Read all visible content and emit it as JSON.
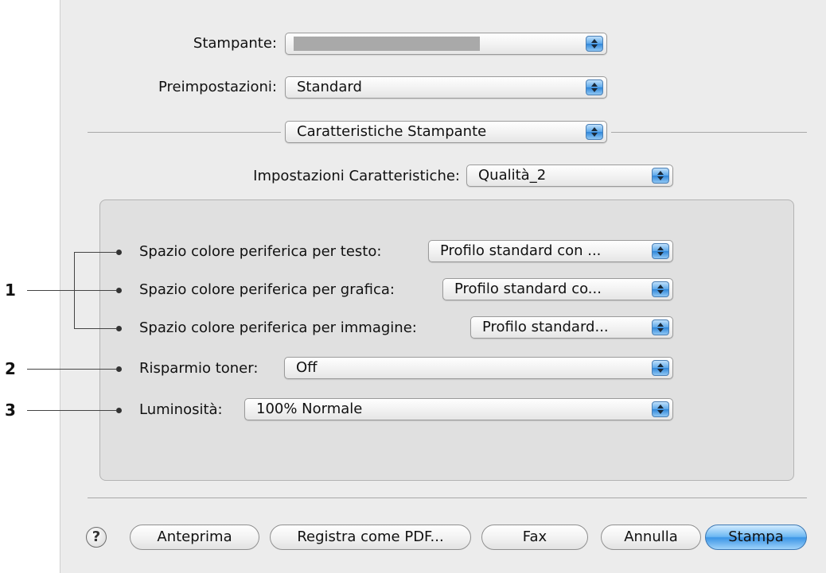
{
  "printer": {
    "label": "Stampante:",
    "value": ""
  },
  "presets": {
    "label": "Preimpostazioni:",
    "value": "Standard"
  },
  "section_popup": {
    "value": "Caratteristiche Stampante"
  },
  "feature_sets": {
    "label": "Impostazioni Caratteristiche:",
    "value": "Qualità_2"
  },
  "settings": [
    {
      "label": "Spazio colore periferica per testo:",
      "value": "Profilo standard con ..."
    },
    {
      "label": "Spazio colore periferica per grafica:",
      "value": "Profilo standard co..."
    },
    {
      "label": "Spazio colore periferica per immagine:",
      "value": "Profilo standard..."
    },
    {
      "label": "Risparmio toner:",
      "value": "Off"
    },
    {
      "label": "Luminosità:",
      "value": "100% Normale"
    }
  ],
  "callouts": [
    "1",
    "2",
    "3"
  ],
  "buttons": {
    "help": "?",
    "preview": "Anteprima",
    "save_pdf": "Registra come PDF...",
    "fax": "Fax",
    "cancel": "Annulla",
    "print": "Stampa"
  },
  "icons": {
    "popup_arrows": "up-down-arrows-icon",
    "help": "question-mark-icon"
  },
  "colors": {
    "accent": "#4a9ae8",
    "panel": "#e0e0e0",
    "window": "#ececec"
  }
}
